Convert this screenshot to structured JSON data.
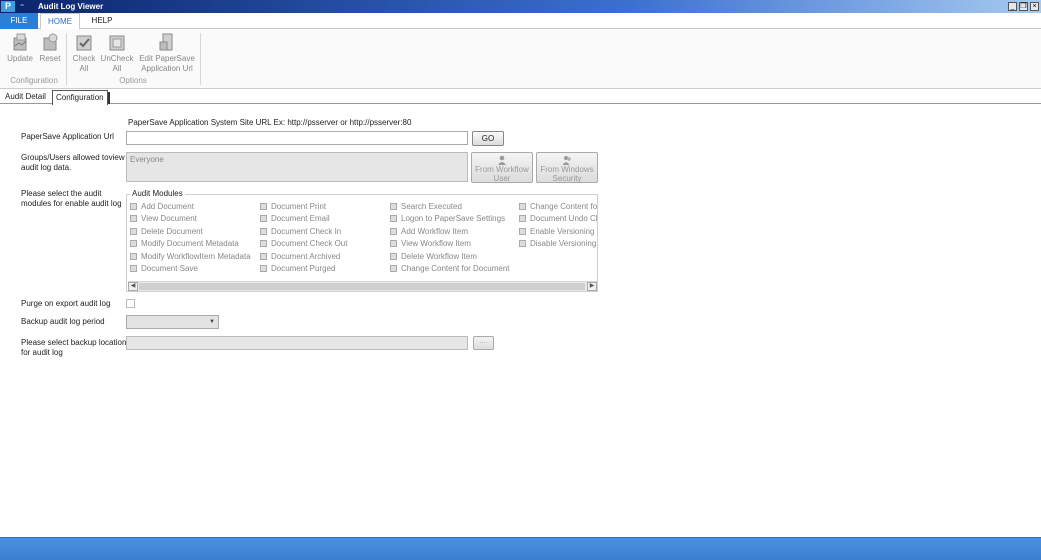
{
  "window": {
    "title": "Audit Log Viewer",
    "app_icon_letter": "P",
    "qat_glyph": "⁼"
  },
  "menu": {
    "file": "FILE",
    "home": "HOME",
    "help": "HELP"
  },
  "ribbon": {
    "update": "Update",
    "reset": "Reset",
    "group_configuration": "Configuration",
    "check_all_line1": "Check",
    "check_all_line2": "All",
    "uncheck_all_line1": "UnCheck",
    "uncheck_all_line2": "All",
    "edit_url_line1": "Edit PaperSave",
    "edit_url_line2": "Application Url",
    "group_options": "Options"
  },
  "tabs": {
    "audit_detail": "Audit Detail",
    "configuration": "Configuration"
  },
  "form": {
    "hint": "PaperSave Application System Site URL Ex: http://psserver or http://psserver:80",
    "app_url_label": "PaperSave Application Url",
    "app_url_value": "",
    "go_button": "GO",
    "groups_label_line1": "Groups/Users allowed toview",
    "groups_label_line2": "audit log data.",
    "groups_value": "Everyone",
    "from_workflow_line1": "From Workflow",
    "from_workflow_line2": "User",
    "from_windows_line1": "From Windows",
    "from_windows_line2": "Security",
    "modules_label_line1": "Please select the audit",
    "modules_label_line2": "modules for enable audit log",
    "modules_group_title": "Audit Modules",
    "modules": [
      [
        "Add Document",
        "View Document",
        "Delete Document",
        "Modify Document Metadata",
        "Modify WorkflowItem Metadata",
        "Document Save"
      ],
      [
        "Document Print",
        "Document Email",
        "Document Check In",
        "Document Check Out",
        "Document Archived",
        "Document Purged"
      ],
      [
        "Search Executed",
        "Logon to PaperSave Settings",
        "Add Workflow Item",
        "View Workflow Item",
        "Delete Workflow Item",
        "Change Content for Document"
      ],
      [
        "Change Content for",
        "Document Undo Ch",
        "Enable Versioning",
        "Disable Versioning"
      ]
    ],
    "purge_label": "Purge on export audit log",
    "purge_checked": false,
    "backup_period_label": "Backup audit log period",
    "backup_period_value": "",
    "backup_location_label_line1": "Please select backup location",
    "backup_location_label_line2": "for audit log",
    "backup_location_value": "",
    "browse_button": "...."
  }
}
